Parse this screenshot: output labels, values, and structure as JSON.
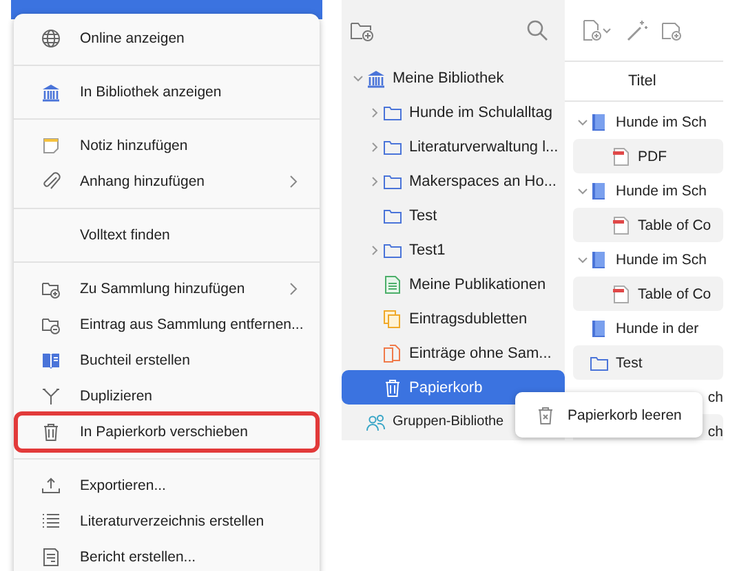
{
  "context_menu": {
    "groups": [
      {
        "items": [
          {
            "label": "Online anzeigen",
            "submenu": false,
            "highlighted": false
          }
        ]
      },
      {
        "items": [
          {
            "label": "In Bibliothek anzeigen",
            "submenu": false,
            "highlighted": false
          }
        ]
      },
      {
        "items": [
          {
            "label": "Notiz hinzufügen",
            "submenu": false,
            "highlighted": false
          },
          {
            "label": "Anhang hinzufügen",
            "submenu": true,
            "highlighted": false
          }
        ]
      },
      {
        "items": [
          {
            "label": "Volltext finden",
            "submenu": false,
            "highlighted": false
          }
        ]
      },
      {
        "items": [
          {
            "label": "Zu Sammlung hinzufügen",
            "submenu": true,
            "highlighted": false
          },
          {
            "label": "Eintrag aus Sammlung entfernen...",
            "submenu": false,
            "highlighted": false
          },
          {
            "label": "Buchteil erstellen",
            "submenu": false,
            "highlighted": false
          },
          {
            "label": "Duplizieren",
            "submenu": false,
            "highlighted": false
          },
          {
            "label": "In Papierkorb verschieben",
            "submenu": false,
            "highlighted": true
          }
        ]
      },
      {
        "items": [
          {
            "label": "Exportieren...",
            "submenu": false,
            "highlighted": false
          },
          {
            "label": "Literaturverzeichnis erstellen",
            "submenu": false,
            "highlighted": false
          },
          {
            "label": "Bericht erstellen...",
            "submenu": false,
            "highlighted": false
          }
        ]
      }
    ]
  },
  "collections_pane": {
    "tree": [
      {
        "label": "Meine Bibliothek",
        "kind": "library",
        "expanded": true,
        "selected": false,
        "children": [
          {
            "label": "Hunde im Schulalltag",
            "kind": "folder",
            "expanded": false,
            "selected": false
          },
          {
            "label": "Literaturverwaltung l...",
            "kind": "folder",
            "expanded": false,
            "selected": false
          },
          {
            "label": "Makerspaces an Ho...",
            "kind": "folder",
            "expanded": false,
            "selected": false
          },
          {
            "label": "Test",
            "kind": "folder",
            "selected": false
          },
          {
            "label": "Test1",
            "kind": "folder",
            "expanded": false,
            "selected": false
          },
          {
            "label": "Meine Publikationen",
            "kind": "publications",
            "selected": false
          },
          {
            "label": "Eintragsdubletten",
            "kind": "duplicates",
            "selected": false
          },
          {
            "label": "Einträge ohne Sam...",
            "kind": "unfiled",
            "selected": false
          },
          {
            "label": "Papierkorb",
            "kind": "trash",
            "selected": true
          }
        ]
      },
      {
        "label": "Gruppen-Bibliothe",
        "kind": "group",
        "selected": false
      }
    ]
  },
  "items_pane": {
    "columns": [
      "Titel"
    ],
    "rows": [
      {
        "title": "Hunde im Sch",
        "kind": "book",
        "expanded": true,
        "children": [
          {
            "title": "PDF",
            "kind": "pdf"
          }
        ]
      },
      {
        "title": "Hunde im Sch",
        "kind": "book",
        "expanded": true,
        "children": [
          {
            "title": "Table of Co",
            "kind": "pdf"
          }
        ]
      },
      {
        "title": "Hunde im Sch",
        "kind": "book",
        "expanded": true,
        "children": [
          {
            "title": "Table of Co",
            "kind": "pdf"
          }
        ]
      },
      {
        "title": "Hunde in der",
        "kind": "book"
      },
      {
        "title": "Test",
        "kind": "folder"
      },
      {
        "title": "ch",
        "kind": "covered"
      },
      {
        "title": "ch",
        "kind": "covered"
      }
    ]
  },
  "popup": {
    "label": "Papierkorb leeren"
  }
}
